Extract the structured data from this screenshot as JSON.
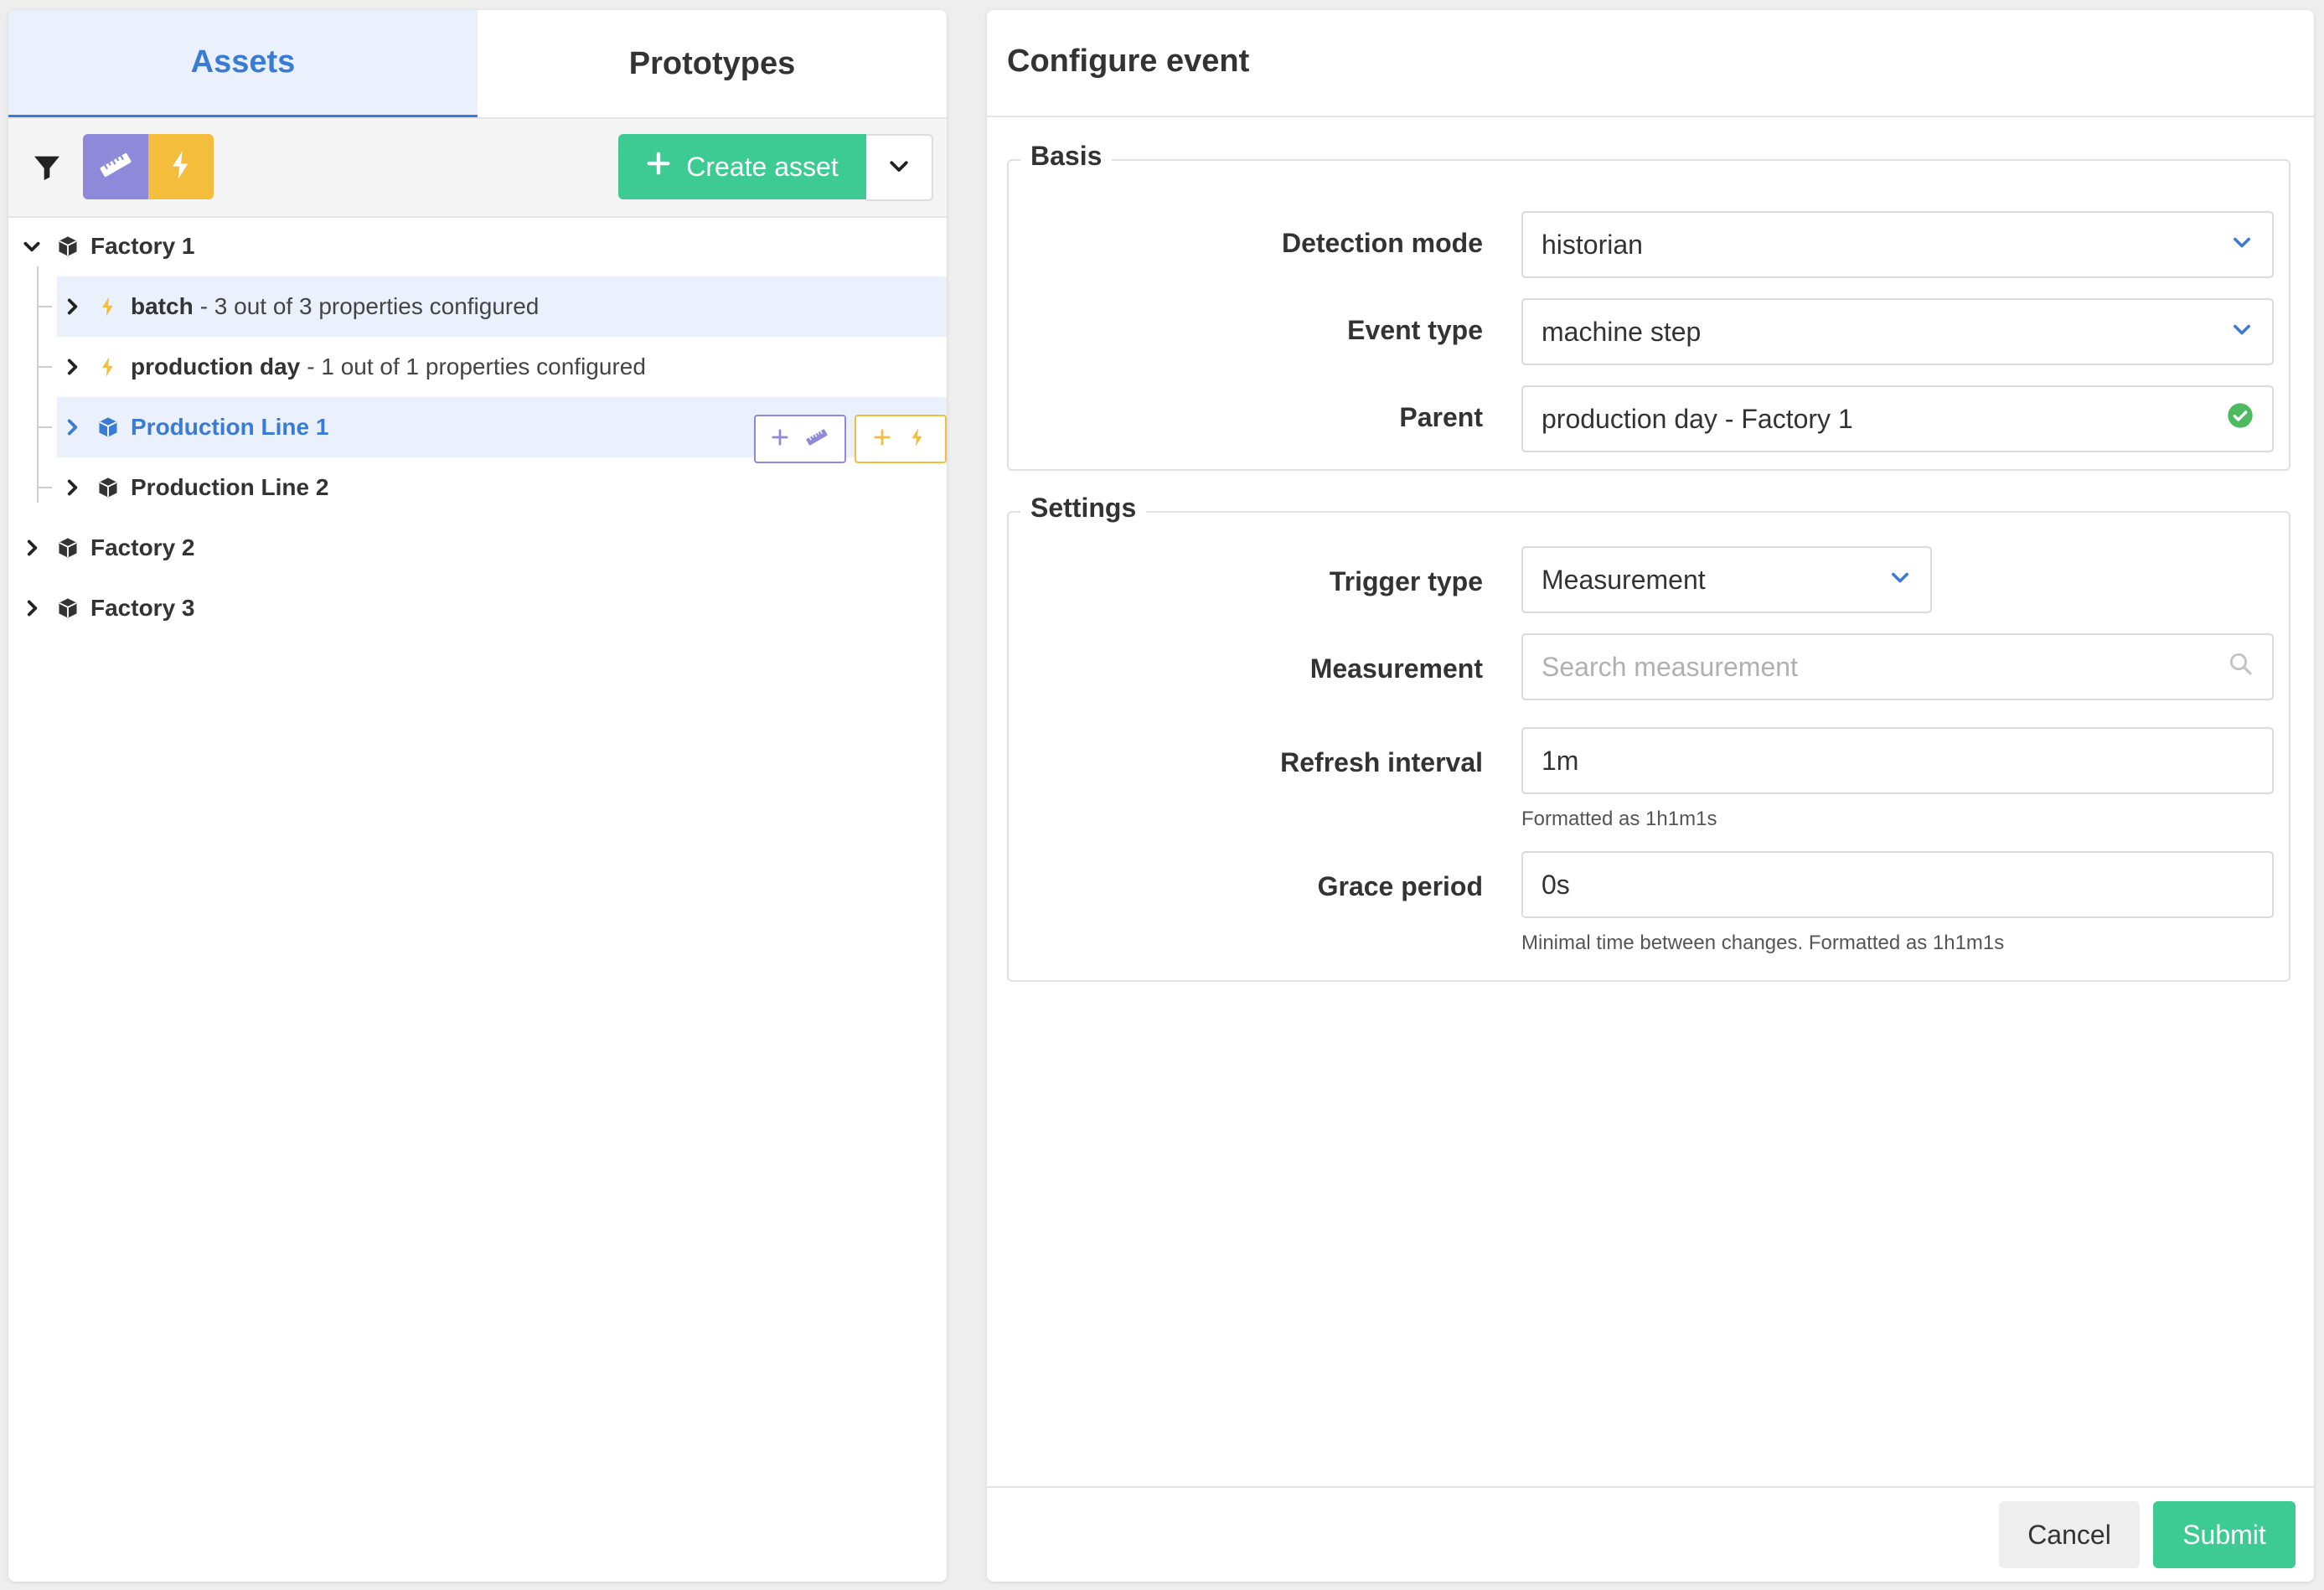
{
  "colors": {
    "accent": "#3a7bd5",
    "success": "#3ecb93",
    "measurement": "#8e89d8",
    "event": "#f5bd3c",
    "selected_row": "#ebf1fc"
  },
  "left": {
    "tabs": [
      {
        "label": "Assets",
        "active": true
      },
      {
        "label": "Prototypes",
        "active": false
      }
    ],
    "toolbar": {
      "filter_icon": "filter-icon",
      "toggle_measurement_icon": "ruler-icon",
      "toggle_event_icon": "lightning-icon",
      "create_label": "Create asset",
      "create_icon": "plus-icon",
      "dropdown_icon": "chevron-down-icon"
    },
    "tree": [
      {
        "label": "Factory 1",
        "icon": "cube-icon",
        "expanded": true
      },
      {
        "label": "batch",
        "detail": "- 3 out of 3 properties configured",
        "icon": "lightning-icon"
      },
      {
        "label": "production day",
        "detail": "- 1 out of 1 properties configured",
        "icon": "lightning-icon"
      },
      {
        "label": "Production Line 1",
        "icon": "cube-icon",
        "selected": true
      },
      {
        "label": "Production Line 2",
        "icon": "cube-icon"
      },
      {
        "label": "Factory 2",
        "icon": "cube-icon"
      },
      {
        "label": "Factory 3",
        "icon": "cube-icon"
      }
    ]
  },
  "right": {
    "title": "Configure event",
    "basis": {
      "legend": "Basis",
      "detection_mode": {
        "label": "Detection mode",
        "value": "historian"
      },
      "event_type": {
        "label": "Event type",
        "value": "machine step"
      },
      "parent": {
        "label": "Parent",
        "value": "production day - Factory 1"
      }
    },
    "settings": {
      "legend": "Settings",
      "trigger_type": {
        "label": "Trigger type",
        "value": "Measurement"
      },
      "measurement": {
        "label": "Measurement",
        "placeholder": "Search measurement"
      },
      "refresh_interval": {
        "label": "Refresh interval",
        "value": "1m",
        "hint": "Formatted as 1h1m1s"
      },
      "grace_period": {
        "label": "Grace period",
        "value": "0s",
        "hint": "Minimal time between changes. Formatted as 1h1m1s"
      }
    },
    "footer": {
      "cancel_label": "Cancel",
      "submit_label": "Submit"
    }
  }
}
